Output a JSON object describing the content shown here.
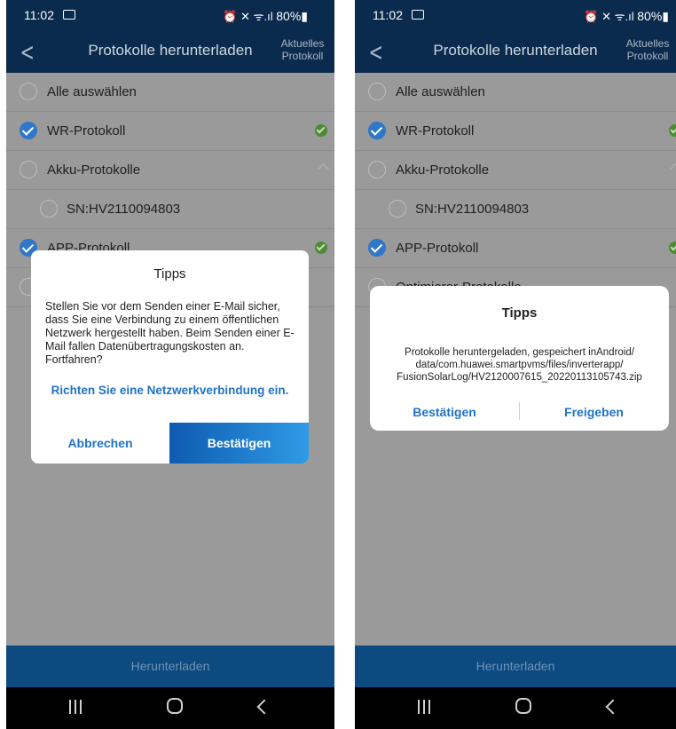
{
  "status_bar": {
    "time": "11:02",
    "indicators": "⏰ ✕ ᯤ.ıl",
    "battery": "80%▮"
  },
  "app_bar": {
    "title": "Protokolle herunterladen",
    "action_line1": "Aktuelles",
    "action_line2": "Protokoll"
  },
  "list": {
    "select_all": "Alle auswählen",
    "wr": "WR-Protokoll",
    "akku": "Akku-Protokolle",
    "sn": "SN:HV2110094803",
    "app": "APP-Protokoll",
    "optimizer": "Optimierer-Protokolle"
  },
  "download_button": "Herunterladen",
  "dialog_left": {
    "title": "Tipps",
    "message": "Stellen Sie vor dem Senden einer E-Mail sicher, dass Sie eine Verbindung zu einem öffentlichen Netzwerk hergestellt haben. Beim Senden einer E-Mail fallen Datenübertragungskosten an. Fortfahren?",
    "link": "Richten Sie eine Netzwerkverbindung ein.",
    "cancel": "Abbrechen",
    "confirm": "Bestätigen"
  },
  "dialog_right": {
    "title": "Tipps",
    "message": "Protokolle heruntergeladen, gespeichert inAndroid/ data/com.huawei.smartpvms/files/inverterapp/ FusionSolarLog/HV2120007615_20220113105743.zip",
    "confirm": "Bestätigen",
    "share": "Freigeben"
  },
  "colors": {
    "header": "#0a2b4d",
    "accent": "#1f73c9",
    "check": "#2f77c8",
    "ok": "#4d8a34"
  }
}
